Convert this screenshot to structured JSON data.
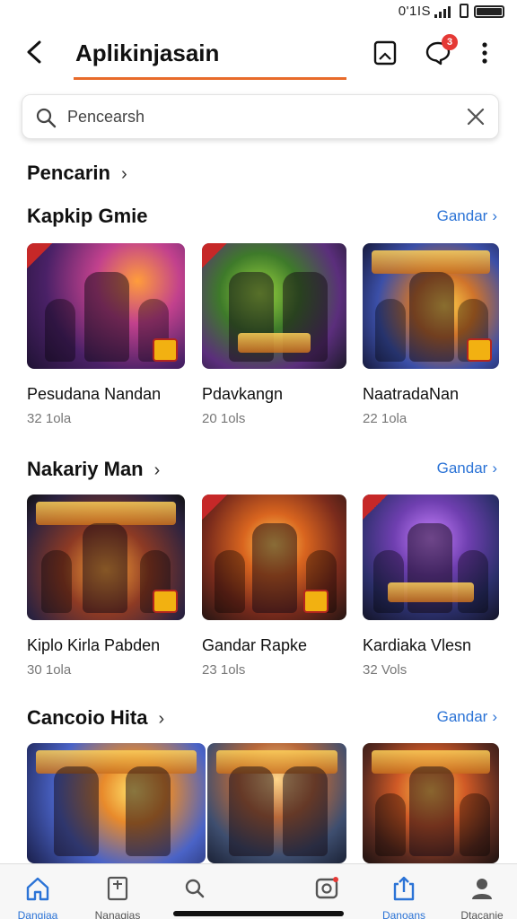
{
  "status_bar": {
    "text": "0'1IS"
  },
  "header": {
    "title": "Aplikinjasain",
    "notification_count": "3",
    "accent_color": "#e86b2a",
    "icons": [
      "back-icon",
      "bookmark-icon",
      "chat-icon",
      "more-icon"
    ]
  },
  "search": {
    "placeholder": "Pencearsh"
  },
  "sections": [
    {
      "title": "Pencarin",
      "see_all": "",
      "cards": []
    },
    {
      "title": "Kapkip Gmie",
      "see_all": "Gandar",
      "cards": [
        {
          "title": "Pesudana Nandan",
          "sub": "32 1ola"
        },
        {
          "title": "Pdavkangn",
          "sub": "20 1ols"
        },
        {
          "title": "NaatradaNan",
          "sub": "22 1ola"
        }
      ]
    },
    {
      "title": "Nakariy Man",
      "see_all": "Gandar",
      "cards": [
        {
          "title": "Kiplo Kirla Pabden",
          "sub": "30 1ola"
        },
        {
          "title": "Gandar Rapke",
          "sub": "23 1ols"
        },
        {
          "title": "Kardiaka Vlesn",
          "sub": "32 Vols"
        }
      ]
    },
    {
      "title": "Cancoio Hita",
      "see_all": "Gandar",
      "cards": [
        {
          "title": ""
        },
        {
          "title": ""
        },
        {
          "title": ""
        }
      ]
    }
  ],
  "bottom_nav": [
    {
      "label": "Dangiaa",
      "icon": "home-icon",
      "active": true
    },
    {
      "label": "Nanagias",
      "icon": "document-icon",
      "active": false
    },
    {
      "label": "",
      "icon": "search-icon",
      "active": false
    },
    {
      "label": "",
      "icon": "camera-icon",
      "active": false
    },
    {
      "label": "Danoans",
      "icon": "share-icon",
      "active": true
    },
    {
      "label": "Dtacanie",
      "icon": "profile-icon",
      "active": false
    }
  ],
  "colors": {
    "accent": "#e86b2a",
    "link": "#2b73d6",
    "badge": "#e53935"
  }
}
